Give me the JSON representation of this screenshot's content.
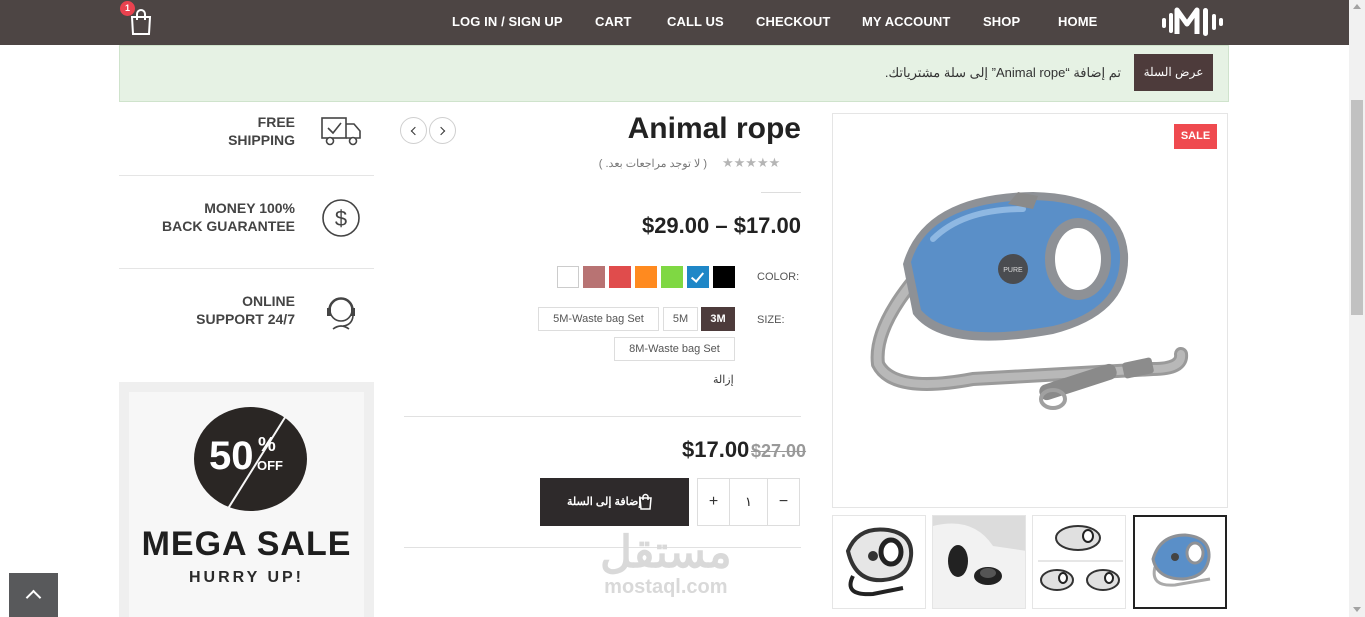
{
  "header": {
    "cart_count": "1",
    "nav": [
      "LOG IN / SIGN UP",
      "CART",
      "CALL US",
      "CHECKOUT",
      "MY ACCOUNT",
      "SHOP",
      "HOME"
    ],
    "bar_color": "#4d4544"
  },
  "notice": {
    "message": "تم إضافة “Animal rope” إلى سلة مشترياتك.",
    "view_cart_label": "عرض السلة"
  },
  "features": [
    {
      "text": "FREE\nSHIPPING",
      "icon": "truck-check-icon"
    },
    {
      "text": "MONEY 100%\nBACK GUARANTEE",
      "icon": "dollar-coin-icon"
    },
    {
      "text": "ONLINE\nSUPPORT 24/7",
      "icon": "headset-support-icon"
    }
  ],
  "promo": {
    "discount_number": "50",
    "discount_percent": "%",
    "discount_off": "OFF",
    "headline": "MEGA SALE",
    "subline": "HURRY UP!"
  },
  "product": {
    "title": "Animal rope",
    "reviews_text": "( لا توجد مراجعات بعد. )",
    "price_range": "$29.00 – $17.00",
    "color_label": "COLOR:",
    "colors": [
      "#000000",
      "#1f87c7",
      "#7fd843",
      "#ff8a1f",
      "#e04c4c",
      "#b87373",
      "#ffffff"
    ],
    "selected_color_index": 1,
    "size_label": "SIZE:",
    "sizes": [
      "3M",
      "5M",
      "5M-Waste bag Set",
      "8M-Waste bag Set"
    ],
    "selected_size": "3M",
    "clear_label": "إزالة",
    "sale_price": "$17.00",
    "old_price": "$27.00",
    "add_to_cart_label": "إضافة إلى السلة",
    "quantity": "١",
    "qty_plus": "+",
    "qty_minus": "−",
    "sale_badge": "SALE"
  },
  "watermark": {
    "arabic": "مستقل",
    "latin": "mostaql.com"
  }
}
